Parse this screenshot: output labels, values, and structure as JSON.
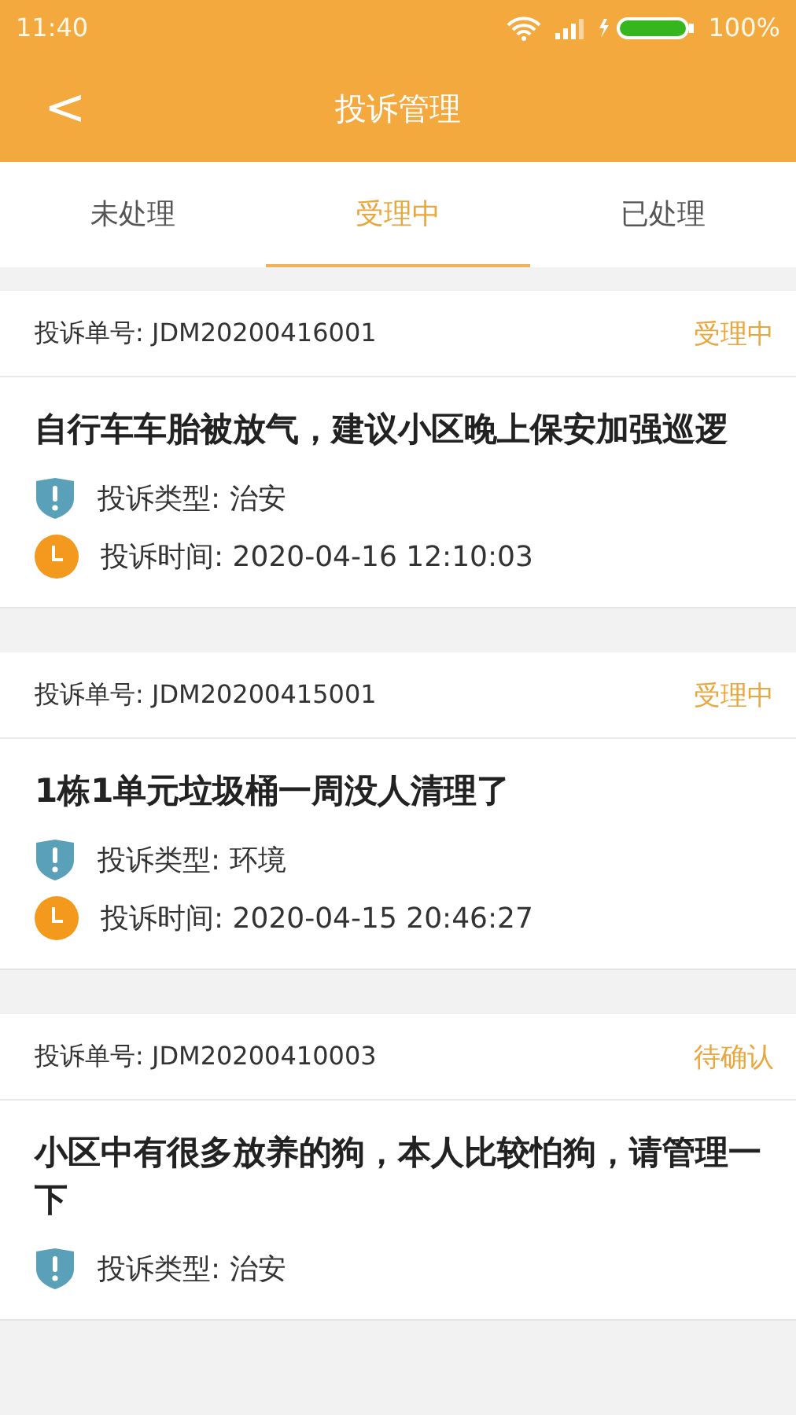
{
  "status_bar": {
    "time": "11:40",
    "battery": "100%"
  },
  "header": {
    "back": "<",
    "title": "投诉管理"
  },
  "tabs": [
    {
      "label": "未处理",
      "selected": false
    },
    {
      "label": "受理中",
      "selected": true
    },
    {
      "label": "已处理",
      "selected": false
    }
  ],
  "complaints": [
    {
      "number": "投诉单号: JDM20200416001",
      "status": "受理中",
      "title": "自行车车胎被放气，建议小区晚上保安加强巡逻",
      "type": "投诉类型: 治安",
      "time": "投诉时间: 2020-04-16 12:10:03"
    },
    {
      "number": "投诉单号: JDM20200415001",
      "status": "受理中",
      "title": "1栋1单元垃圾桶一周没人清理了",
      "type": "投诉类型: 环境",
      "time": "投诉时间: 2020-04-15 20:46:27"
    },
    {
      "number": "投诉单号: JDM20200410003",
      "status": "待确认",
      "title": "小区中有很多放养的狗，本人比较怕狗，请管理一下",
      "type": "投诉类型: 治安"
    }
  ]
}
